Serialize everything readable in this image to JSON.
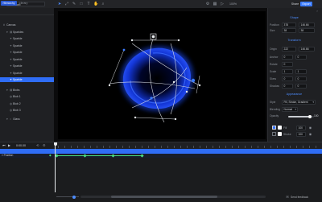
{
  "toolbar": {
    "project_name": "Lucid orb",
    "zoom": "100%",
    "share_label": "Share",
    "export_label": "Export",
    "tools": [
      "select-icon",
      "transform-icon",
      "pen-icon",
      "shape-icon",
      "text-icon",
      "hand-icon"
    ]
  },
  "left_panel": {
    "tabs": [
      "Hierarchy",
      "Library"
    ],
    "tree": [
      {
        "label": "Canvas",
        "icon": "frame-icon",
        "depth": 0,
        "selected": false
      },
      {
        "label": "Sparkles",
        "icon": "group-icon",
        "depth": 1,
        "selected": false
      },
      {
        "label": "Sparkle",
        "icon": "star-icon",
        "depth": 2,
        "selected": false
      },
      {
        "label": "Sparkle",
        "icon": "star-icon",
        "depth": 2,
        "selected": false
      },
      {
        "label": "Sparkle",
        "icon": "star-icon",
        "depth": 2,
        "selected": false
      },
      {
        "label": "Sparkle",
        "icon": "star-icon",
        "depth": 2,
        "selected": false
      },
      {
        "label": "Sparkle",
        "icon": "star-icon",
        "depth": 2,
        "selected": false
      },
      {
        "label": "Sparkle",
        "icon": "star-icon",
        "depth": 2,
        "selected": false
      },
      {
        "label": "Sparkle",
        "icon": "star-icon",
        "depth": 2,
        "selected": true
      },
      {
        "label": "Blobs",
        "icon": "group-icon",
        "depth": 1,
        "selected": false
      },
      {
        "label": "Blob 1",
        "icon": "blob-icon",
        "depth": 2,
        "selected": false
      },
      {
        "label": "Blob 2",
        "icon": "blob-icon",
        "depth": 2,
        "selected": false
      },
      {
        "label": "Blob 3",
        "icon": "blob-icon",
        "depth": 2,
        "selected": false
      },
      {
        "label": "Glass",
        "icon": "circle-icon",
        "depth": 1,
        "selected": false
      }
    ]
  },
  "right_panel": {
    "sections": {
      "shape": "Shape",
      "transform": "Transform",
      "appearance": "Appearance"
    },
    "position": {
      "label": "Position",
      "x": "378",
      "y": "146.66"
    },
    "size": {
      "label": "Size",
      "w": "38",
      "h": "38"
    },
    "origin": {
      "label": "Origin",
      "x": "222",
      "y": "146.66"
    },
    "anchor": {
      "label": "Anchor",
      "x": "0",
      "y": "0"
    },
    "rotate": {
      "label": "Rotate",
      "value": "0"
    },
    "scale": {
      "label": "Scale",
      "x": "1",
      "y": "1"
    },
    "skew": {
      "label": "Skew",
      "x": "0",
      "y": "0"
    },
    "shadow": {
      "label": "Shadow",
      "x": "0",
      "y": "0"
    },
    "style": {
      "label": "Style",
      "value": "Fill, Stroke, Gradient"
    },
    "blending": {
      "label": "Blending",
      "value": "Normal"
    },
    "opacity": {
      "label": "Opacity",
      "value": "100",
      "fraction": 0.83
    },
    "fill": {
      "label": "Fill",
      "value": "100"
    },
    "stroke": {
      "label": "Stroke",
      "value": "100"
    }
  },
  "timeline": {
    "time": "0:00.00",
    "track_name": "Position",
    "keyframes_fraction": [
      0.0,
      0.33,
      0.66,
      1.0
    ]
  },
  "footer": {
    "feedback_label": "Send feedback"
  },
  "colors": {
    "accent": "#2f6df6",
    "keyframe": "#4ade80",
    "orb": "#1d4dff"
  }
}
